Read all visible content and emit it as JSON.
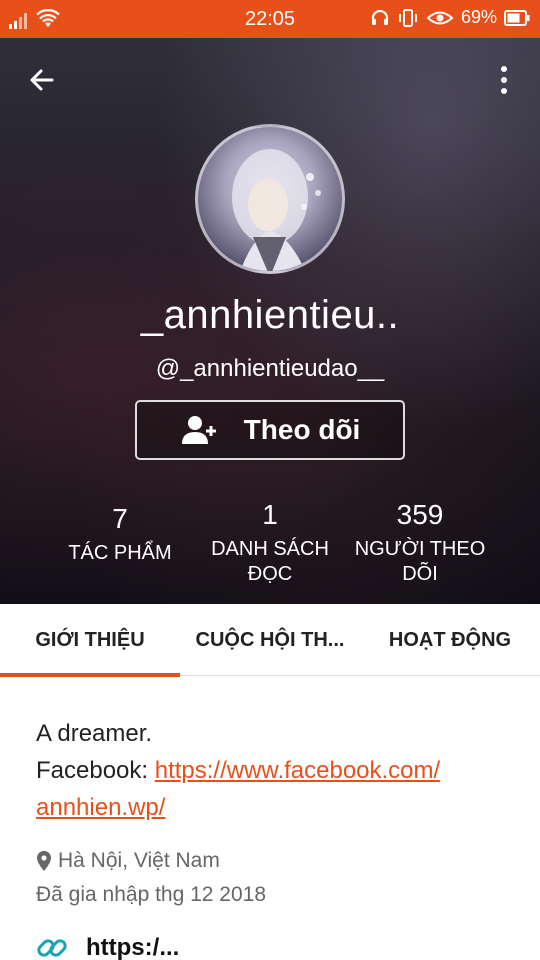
{
  "status_bar": {
    "time": "22:05",
    "battery": "69%",
    "icons": [
      "signal-icon",
      "wifi-icon",
      "headset-icon",
      "vibrate-icon",
      "eye-icon",
      "battery-icon"
    ]
  },
  "header": {
    "display_name": "_annhientieu..",
    "username": "@_annhientieudao__",
    "follow_label": "Theo dõi"
  },
  "stats": [
    {
      "value": "7",
      "label": "TÁC PHẨM"
    },
    {
      "value": "1",
      "label_line1": "DANH SÁCH",
      "label_line2": "ĐỌC"
    },
    {
      "value": "359",
      "label_line1": "NGƯỜI THEO",
      "label_line2": "DÕI"
    }
  ],
  "tabs": [
    {
      "label": "GIỚI THIỆU",
      "active": true
    },
    {
      "label": "CUỘC HỘI TH..."
    },
    {
      "label": "HOẠT ĐỘNG"
    }
  ],
  "about": {
    "bio_line1": "A dreamer.",
    "facebook_prefix": "Facebook: ",
    "facebook_link_part1": "https://www.facebook.com/",
    "facebook_link_part2": "annhien.wp/",
    "location": "Hà Nội, Việt Nam",
    "joined": "Đã gia nhập thg 12 2018",
    "link_text": "https:/..."
  },
  "colors": {
    "accent": "#e8501a"
  }
}
